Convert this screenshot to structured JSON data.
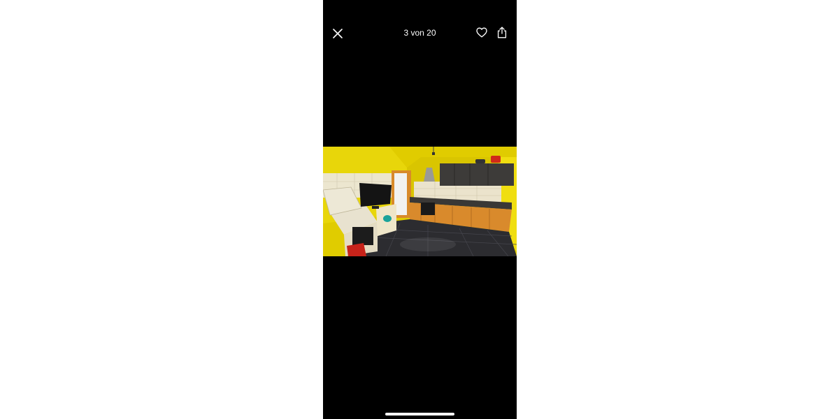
{
  "viewer": {
    "counter_text": "3 von 20",
    "icons": {
      "close": "close-icon",
      "favorite": "heart-icon",
      "share": "share-icon"
    }
  },
  "photo": {
    "subject": "kitchen-photo"
  },
  "colors": {
    "background": "#000000",
    "page": "#ffffff",
    "icon": "#ffffff"
  }
}
